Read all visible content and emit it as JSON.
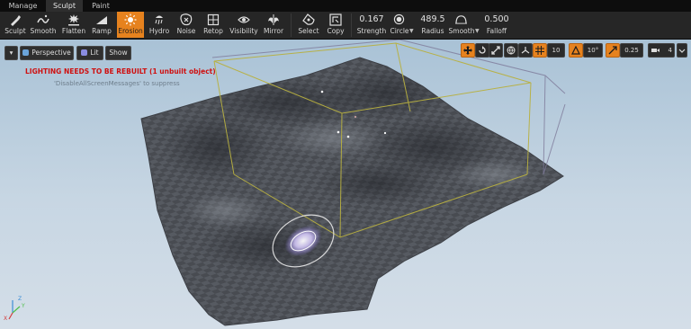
{
  "mode_tabs": [
    {
      "label": "Manage",
      "active": false
    },
    {
      "label": "Sculpt",
      "active": true
    },
    {
      "label": "Paint",
      "active": false
    }
  ],
  "tools": [
    {
      "label": "Sculpt",
      "icon": "sculpt-brush-icon",
      "active": false
    },
    {
      "label": "Smooth",
      "icon": "smooth-icon",
      "active": false
    },
    {
      "label": "Flatten",
      "icon": "flatten-icon",
      "active": false
    },
    {
      "label": "Ramp",
      "icon": "ramp-icon",
      "active": false
    },
    {
      "label": "Erosion",
      "icon": "erosion-icon",
      "active": true
    },
    {
      "label": "Hydro",
      "icon": "hydro-icon",
      "active": false
    },
    {
      "label": "Noise",
      "icon": "noise-icon",
      "active": false
    },
    {
      "label": "Retop",
      "icon": "retopologize-icon",
      "active": false
    },
    {
      "label": "Visibility",
      "icon": "visibility-icon",
      "active": false
    },
    {
      "label": "Mirror",
      "icon": "mirror-icon",
      "active": false
    }
  ],
  "edit_tools": [
    {
      "label": "Select",
      "icon": "select-icon"
    },
    {
      "label": "Copy",
      "icon": "copy-icon"
    }
  ],
  "brush": {
    "strength": {
      "value": "0.167",
      "label": "Strength"
    },
    "shape": {
      "label": "Circle",
      "icon": "circle-brush-icon"
    },
    "radius": {
      "value": "489.5",
      "label": "Radius"
    },
    "falloff_type": {
      "label": "Smooth",
      "icon": "smooth-falloff-icon"
    },
    "falloff": {
      "value": "0.500",
      "label": "Falloff"
    }
  },
  "viewport": {
    "menu_label": "▾",
    "view_mode": "Perspective",
    "lighting_mode": "Lit",
    "show_label": "Show",
    "warning": "LIGHTING NEEDS TO BE REBUILT (1 unbuilt object)",
    "warning_hint": "'DisableAllScreenMessages' to suppress",
    "grid_snap_value": "10",
    "rotation_snap_value": "10°",
    "scale_snap_value": "0.25",
    "camera_speed_value": "4",
    "colors": {
      "accent_orange": "#e6821e",
      "warning_red": "#cf1010",
      "sky_top": "#a9c2d6",
      "bounds_yellow": "#b8b040",
      "brush_cursor": "#d4c8ff"
    }
  },
  "axis": {
    "x": "X",
    "y": "Y",
    "z": "Z"
  }
}
